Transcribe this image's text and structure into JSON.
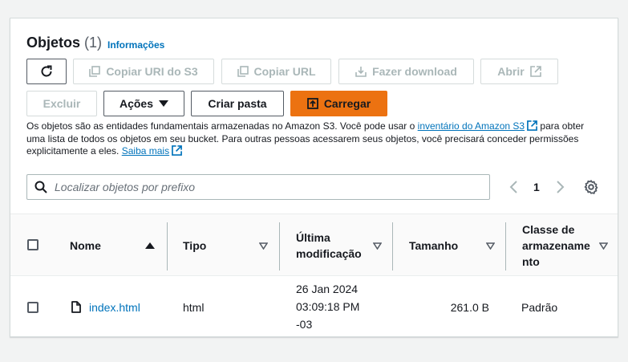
{
  "header": {
    "title": "Objetos",
    "count": "(1)",
    "info_link": "Informações"
  },
  "toolbar": {
    "refresh_label": "",
    "copy_uri_label": "Copiar URI do S3",
    "copy_url_label": "Copiar URL",
    "download_label": "Fazer download",
    "open_label": "Abrir",
    "delete_label": "Excluir",
    "actions_label": "Ações",
    "create_folder_label": "Criar pasta",
    "upload_label": "Carregar"
  },
  "description": {
    "text1": "Os objetos são as entidades fundamentais armazenadas no Amazon S3. Você pode usar o ",
    "link1": "inventário do Amazon S3",
    "text2": " para obter uma lista de todos os objetos em seu bucket. Para outras pessoas acessarem seus objetos, você precisará conceder permissões explicitamente a eles. ",
    "link2": "Saiba mais"
  },
  "search": {
    "placeholder": "Localizar objetos por prefixo",
    "value": ""
  },
  "pagination": {
    "current_page": "1"
  },
  "table": {
    "columns": [
      {
        "label_lines": [
          "Nome"
        ]
      },
      {
        "label_lines": [
          "Tipo"
        ]
      },
      {
        "label_lines": [
          "Última",
          "modificação"
        ]
      },
      {
        "label_lines": [
          "Tamanho"
        ]
      },
      {
        "label_lines": [
          "Classe de",
          "armazename",
          "nto"
        ]
      }
    ],
    "rows": [
      {
        "name": "index.html",
        "type": "html",
        "modified_lines": [
          "26 Jan 2024",
          "03:09:18 PM",
          "-03"
        ],
        "size": "261.0 B",
        "storage_class": "Padrão"
      }
    ]
  },
  "colors": {
    "primary_button": "#ec7211",
    "link": "#0073bb",
    "text": "#16191f",
    "disabled_text": "#aab7b8"
  },
  "icons": [
    "refresh-icon",
    "copy-icon",
    "download-icon",
    "external-link-icon",
    "caret-down-icon",
    "upload-icon",
    "search-icon",
    "chevron-left-icon",
    "chevron-right-icon",
    "gear-icon",
    "sort-ascending-icon",
    "sort-icon",
    "file-icon"
  ]
}
